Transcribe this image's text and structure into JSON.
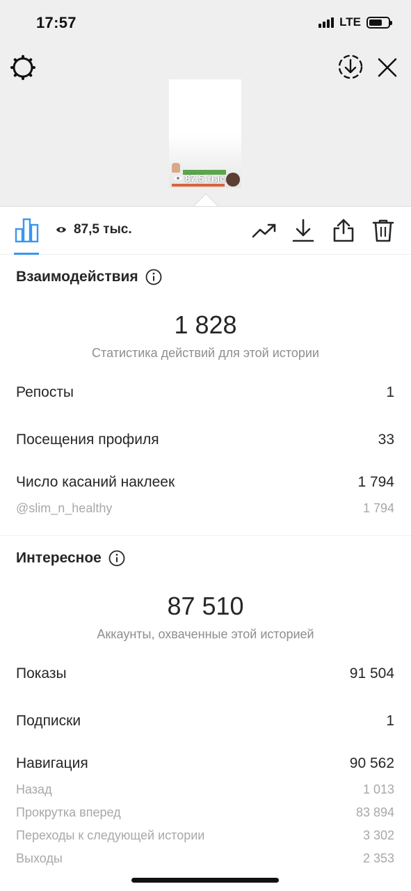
{
  "status_bar": {
    "time": "17:57",
    "network": "LTE",
    "battery_level": 0.7
  },
  "preview": {
    "views": "87,5 тыс."
  },
  "toolbar": {
    "views": "87,5 тыс."
  },
  "interactions": {
    "title": "Взаимодействия",
    "total": "1 828",
    "caption": "Статистика действий для этой истории",
    "rows": [
      {
        "label": "Репосты",
        "value": "1"
      },
      {
        "label": "Посещения профиля",
        "value": "33"
      },
      {
        "label": "Число касаний наклеек",
        "value": "1 794"
      }
    ],
    "sub_rows": [
      {
        "label": "@slim_n_healthy",
        "value": "1 794"
      }
    ]
  },
  "discovery": {
    "title": "Интересное",
    "total": "87 510",
    "caption": "Аккаунты, охваченные этой историей",
    "rows": [
      {
        "label": "Показы",
        "value": "91 504"
      },
      {
        "label": "Подписки",
        "value": "1"
      },
      {
        "label": "Навигация",
        "value": "90 562"
      }
    ],
    "sub_rows": [
      {
        "label": "Назад",
        "value": "1 013"
      },
      {
        "label": "Прокрутка вперед",
        "value": "83 894"
      },
      {
        "label": "Переходы к следующей истории",
        "value": "3 302"
      },
      {
        "label": "Выходы",
        "value": "2 353"
      }
    ]
  },
  "colors": {
    "accent": "#3897f0",
    "text": "#262626",
    "secondary": "#8e8e8e",
    "header_bg": "#efefef"
  }
}
